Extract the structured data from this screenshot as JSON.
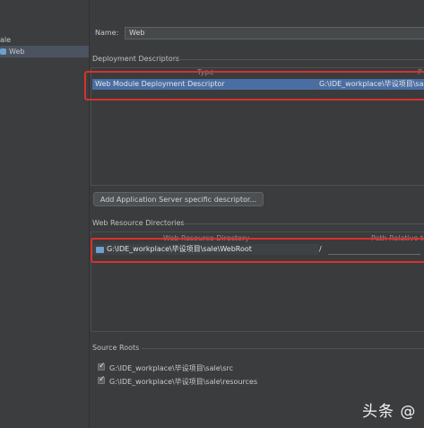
{
  "tree": {
    "root_label": "ale",
    "web_label": "Web"
  },
  "name_field": {
    "label": "Name:",
    "value": "Web"
  },
  "deployment_descriptors": {
    "title": "Deployment Descriptors",
    "columns": [
      "Type",
      "P"
    ],
    "rows": [
      {
        "type": "Web Module Deployment Descriptor",
        "path": "G:\\IDE_workplace\\毕设项目\\sale"
      }
    ]
  },
  "add_server_button": {
    "label": "Add Application Server specific descriptor..."
  },
  "web_resource_directories": {
    "title": "Web Resource Directories",
    "columns": [
      "Web Resource Directory",
      "Path Relative to"
    ],
    "rows": [
      {
        "directory": "G:\\IDE_workplace\\毕设项目\\sale\\WebRoot",
        "relative": "/"
      }
    ]
  },
  "source_roots": {
    "title": "Source Roots",
    "items": [
      {
        "path": "G:\\IDE_workplace\\毕设项目\\sale\\src",
        "checked": true
      },
      {
        "path": "G:\\IDE_workplace\\毕设项目\\sale\\resources",
        "checked": true
      }
    ]
  },
  "watermark": {
    "text": "头条 @"
  },
  "colors": {
    "highlight": "#d9312b",
    "selection": "#4a6ea3",
    "background": "#3a3c3e"
  }
}
